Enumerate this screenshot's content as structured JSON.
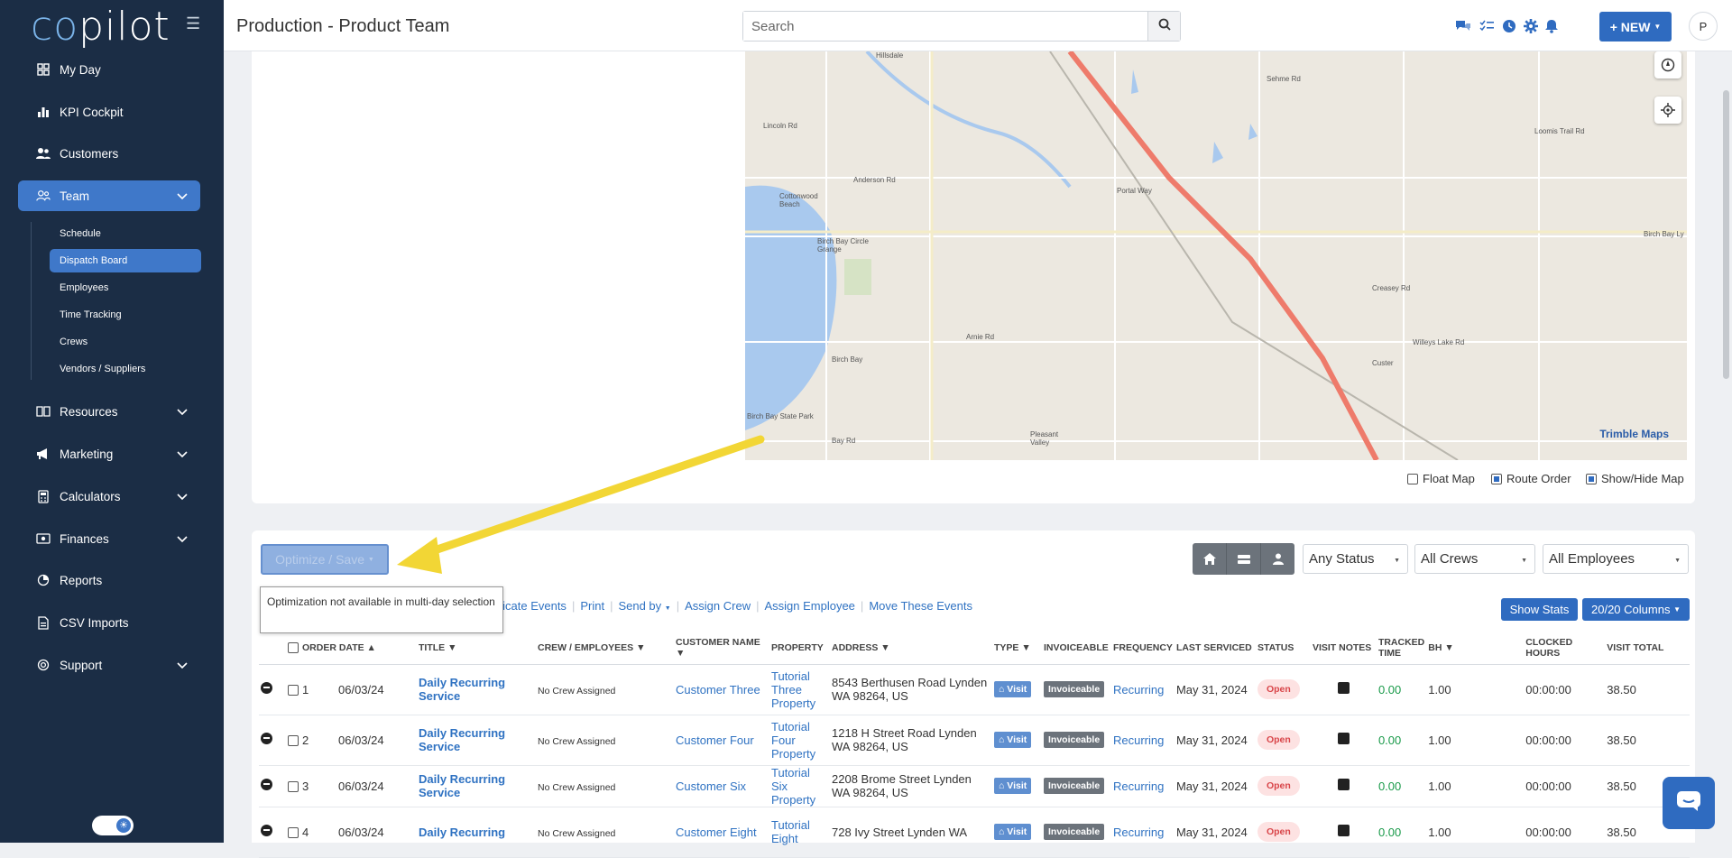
{
  "app": {
    "logo_co": "co",
    "logo_rest": "pilot",
    "page_title": "Production - Product Team"
  },
  "sidebar": {
    "items": [
      {
        "label": "My Day",
        "icon": "grid-icon"
      },
      {
        "label": "KPI Cockpit",
        "icon": "bar-chart-icon"
      },
      {
        "label": "Customers",
        "icon": "users-icon"
      },
      {
        "label": "Team",
        "icon": "team-icon"
      },
      {
        "label": "Resources",
        "icon": "book-icon"
      },
      {
        "label": "Marketing",
        "icon": "megaphone-icon"
      },
      {
        "label": "Calculators",
        "icon": "calculator-icon"
      },
      {
        "label": "Finances",
        "icon": "money-icon"
      },
      {
        "label": "Reports",
        "icon": "chart-pie-icon"
      },
      {
        "label": "CSV Imports",
        "icon": "file-csv-icon"
      },
      {
        "label": "Support",
        "icon": "lifebuoy-icon"
      }
    ],
    "team_sub": [
      "Schedule",
      "Dispatch Board",
      "Employees",
      "Time Tracking",
      "Crews",
      "Vendors / Suppliers"
    ]
  },
  "header": {
    "search_placeholder": "Search",
    "new_label": "+ NEW",
    "avatar_initial": "P"
  },
  "map": {
    "labels": [
      "Hillsdale",
      "Lincoln Rd",
      "Anderson Rd",
      "Cottonwood Beach",
      "Birch Bay Circle Grange",
      "Birch Bay",
      "Birch Bay State Park",
      "Bay Rd",
      "Pleasant Valley",
      "Arnie Rd",
      "Custer",
      "Creasey Rd",
      "Willeys Lake Rd",
      "Loomis Trail Rd",
      "Sehme Rd",
      "Portal Way",
      "Birch Bay Ly"
    ],
    "attribution": "Trimble Maps",
    "options": {
      "float": "Float Map",
      "route": "Route Order",
      "showhide": "Show/Hide Map"
    }
  },
  "toolbar": {
    "optimize": "Optimize / Save",
    "tooltip": "Optimization not available in multi-day selection",
    "actions": [
      "plicate Events",
      "Print",
      "Send by",
      "Assign Crew",
      "Assign Employee",
      "Move These Events"
    ],
    "status": "Any Status",
    "crews": "All Crews",
    "employees": "All Employees",
    "show_stats": "Show Stats",
    "columns": "20/20 Columns"
  },
  "table": {
    "headers": [
      "ORDER DATE",
      "TITLE",
      "CREW / EMPLOYEES",
      "CUSTOMER NAME",
      "PROPERTY",
      "ADDRESS",
      "TYPE",
      "INVOICEABLE",
      "FREQUENCY",
      "LAST SERVICED",
      "STATUS",
      "VISIT NOTES",
      "TRACKED TIME",
      "BH",
      "CLOCKED HOURS",
      "VISIT TOTAL"
    ],
    "rows": [
      {
        "n": "1",
        "date": "06/03/24",
        "title": "Daily Recurring Service",
        "crew": "No Crew Assigned",
        "customer": "Customer Three",
        "property": "Tutorial Three Property",
        "address": "8543 Berthusen Road Lynden WA 98264, US",
        "type": "Visit",
        "inv": "Invoiceable",
        "freq": "Recurring",
        "last": "May 31, 2024",
        "status": "Open",
        "tracked": "0.00",
        "bh": "1.00",
        "clocked": "00:00:00",
        "total": "38.50"
      },
      {
        "n": "2",
        "date": "06/03/24",
        "title": "Daily Recurring Service",
        "crew": "No Crew Assigned",
        "customer": "Customer Four",
        "property": "Tutorial Four Property",
        "address": "1218 H Street Road Lynden WA 98264, US",
        "type": "Visit",
        "inv": "Invoiceable",
        "freq": "Recurring",
        "last": "May 31, 2024",
        "status": "Open",
        "tracked": "0.00",
        "bh": "1.00",
        "clocked": "00:00:00",
        "total": "38.50"
      },
      {
        "n": "3",
        "date": "06/03/24",
        "title": "Daily Recurring Service",
        "crew": "No Crew Assigned",
        "customer": "Customer Six",
        "property": "Tutorial Six Property",
        "address": "2208 Brome Street Lynden WA 98264, US",
        "type": "Visit",
        "inv": "Invoiceable",
        "freq": "Recurring",
        "last": "May 31, 2024",
        "status": "Open",
        "tracked": "0.00",
        "bh": "1.00",
        "clocked": "00:00:00",
        "total": "38.50"
      },
      {
        "n": "4",
        "date": "06/03/24",
        "title": "Daily Recurring",
        "crew": "No Crew Assigned",
        "customer": "Customer Eight",
        "property": "Tutorial Eight",
        "address": "728 Ivy Street Lynden WA",
        "type": "Visit",
        "inv": "Invoiceable",
        "freq": "Recurring",
        "last": "May 31, 2024",
        "status": "Open",
        "tracked": "0.00",
        "bh": "1.00",
        "clocked": "00:00:00",
        "total": "38.50"
      }
    ]
  },
  "colors": {
    "sidebar": "#1b2d45",
    "accent": "#2f6bc0",
    "open": "#d9464a",
    "water": "#a9c9ee",
    "highway": "#ee7b6b"
  }
}
